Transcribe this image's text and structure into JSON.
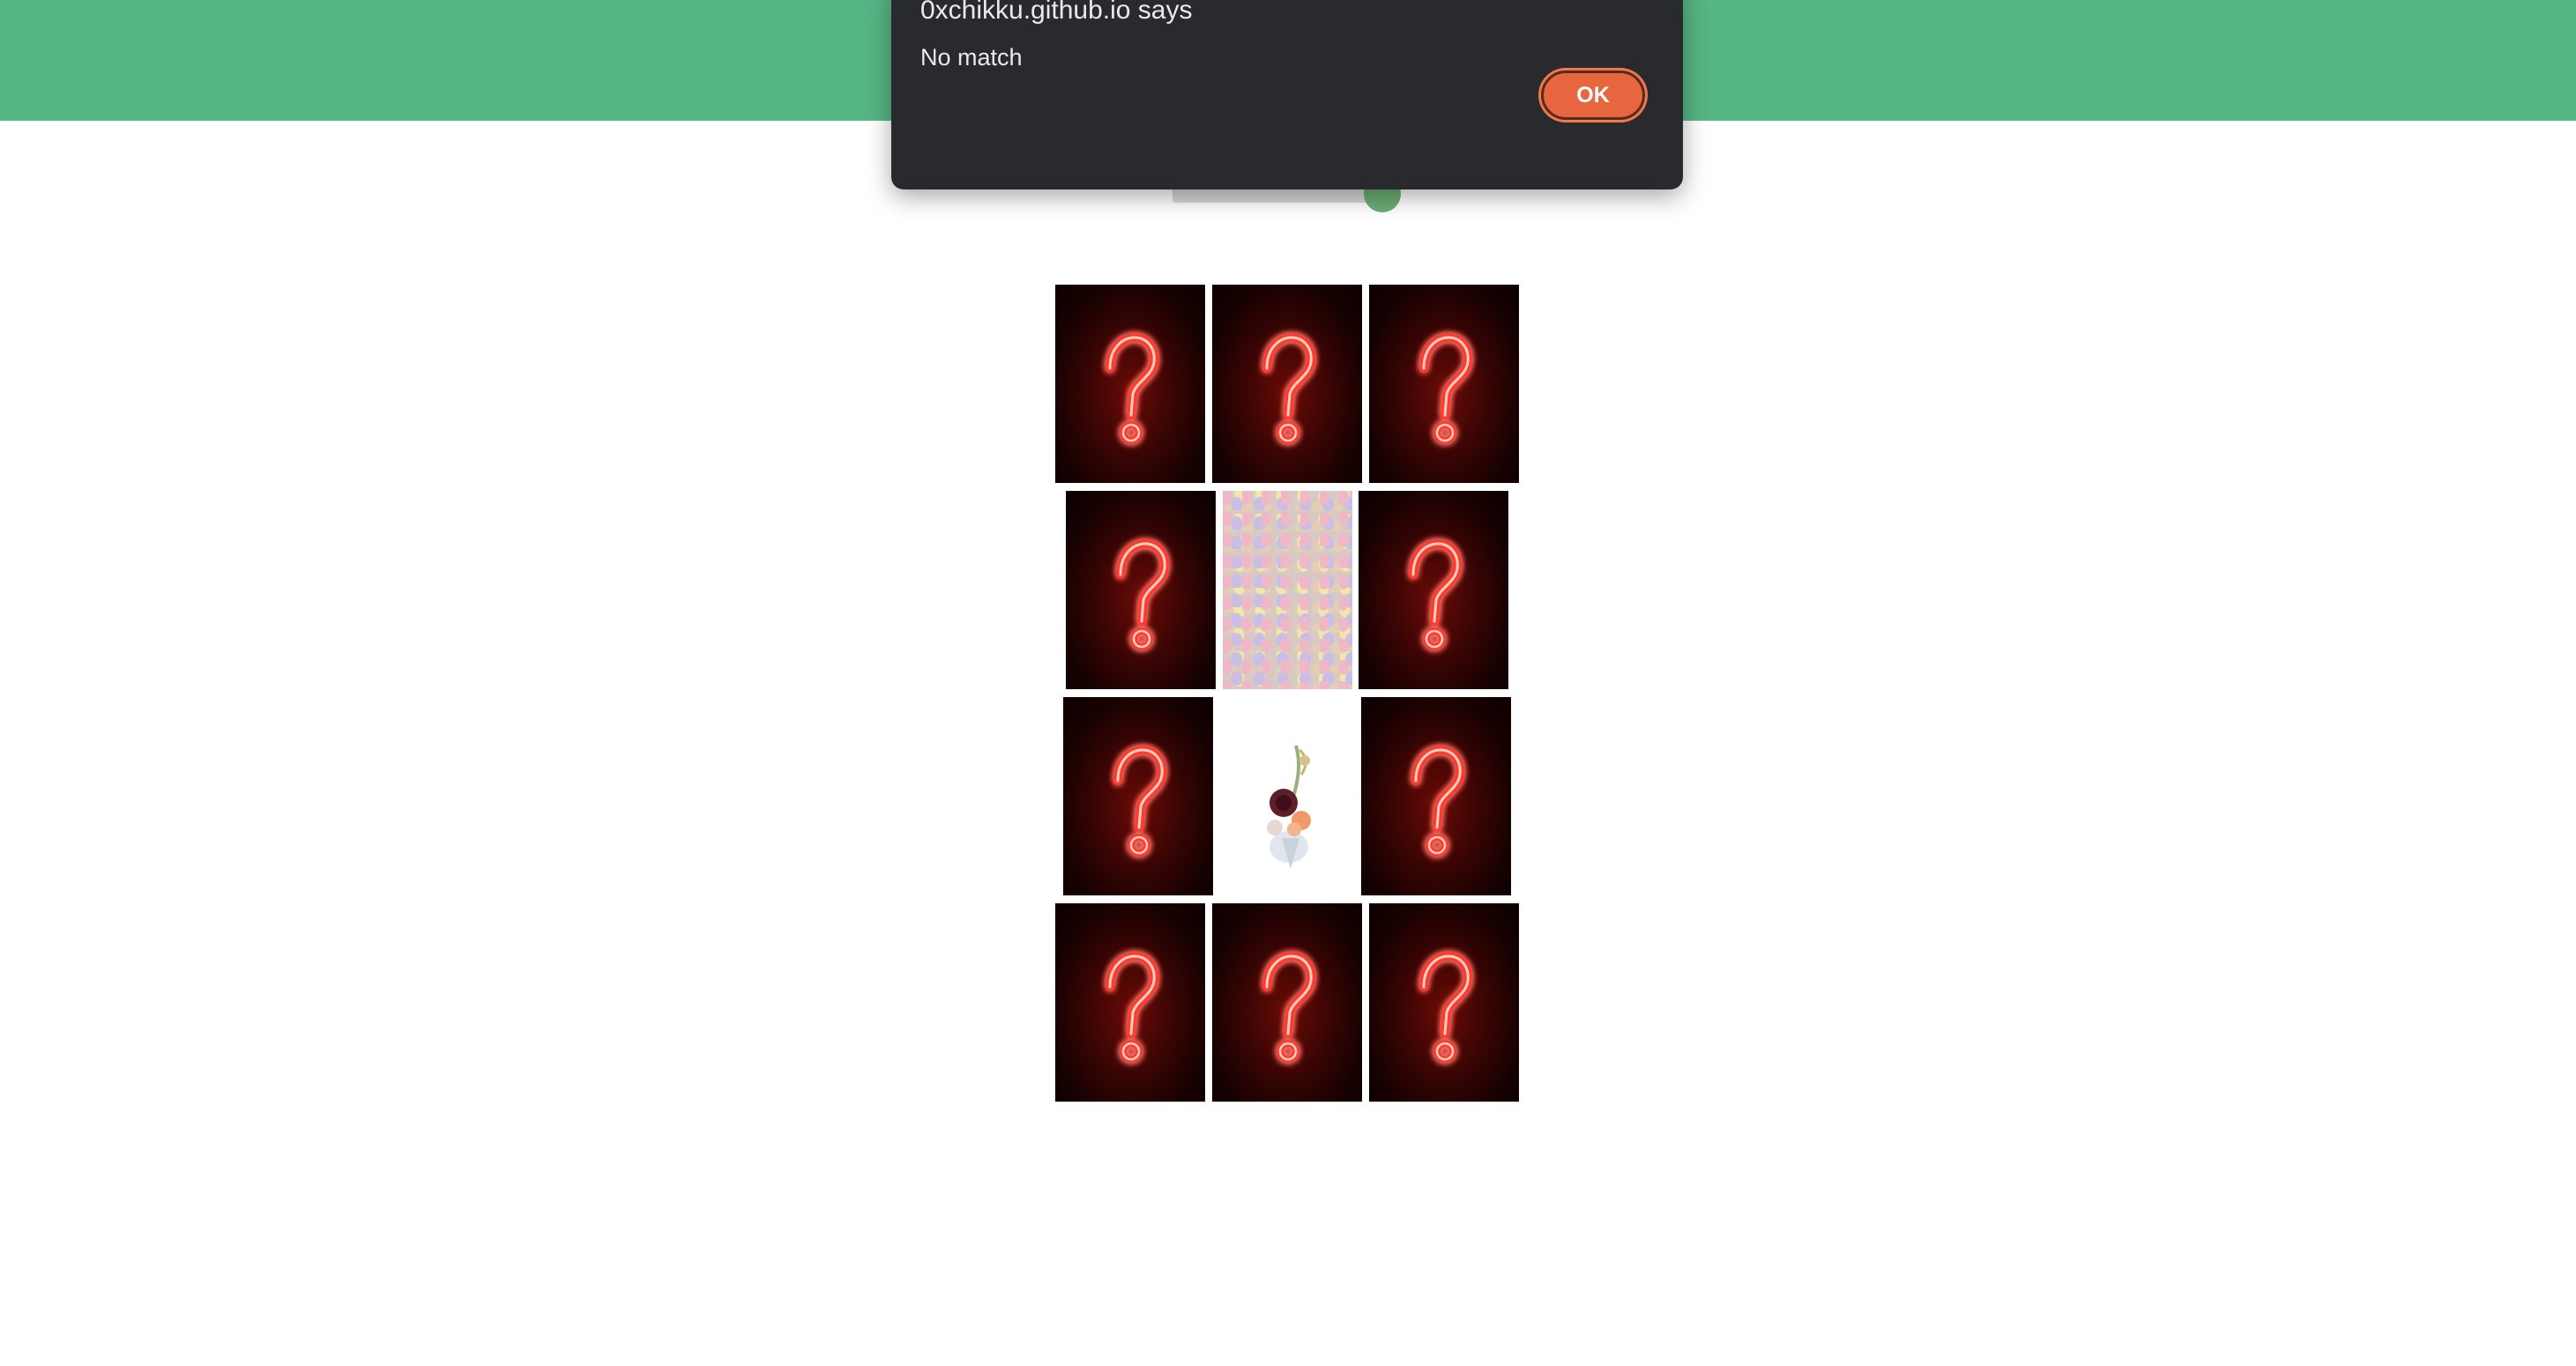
{
  "dialog": {
    "title": "0xchikku.github.io says",
    "message": "No match",
    "ok_label": "OK"
  },
  "board": {
    "rows": 4,
    "columns": 3,
    "cards": [
      {
        "row": 1,
        "col": 1,
        "face": "hidden",
        "icon": "question-mark-icon"
      },
      {
        "row": 1,
        "col": 2,
        "face": "hidden",
        "icon": "question-mark-icon"
      },
      {
        "row": 1,
        "col": 3,
        "face": "hidden",
        "icon": "question-mark-icon"
      },
      {
        "row": 2,
        "col": 1,
        "face": "hidden",
        "icon": "question-mark-icon"
      },
      {
        "row": 2,
        "col": 2,
        "face": "revealed",
        "image": "pastel-candy-eggs"
      },
      {
        "row": 2,
        "col": 3,
        "face": "hidden",
        "icon": "question-mark-icon"
      },
      {
        "row": 3,
        "col": 1,
        "face": "hidden",
        "icon": "question-mark-icon"
      },
      {
        "row": 3,
        "col": 2,
        "face": "revealed",
        "image": "flower-bouquet"
      },
      {
        "row": 3,
        "col": 3,
        "face": "hidden",
        "icon": "question-mark-icon"
      },
      {
        "row": 4,
        "col": 1,
        "face": "hidden",
        "icon": "question-mark-icon"
      },
      {
        "row": 4,
        "col": 2,
        "face": "hidden",
        "icon": "question-mark-icon"
      },
      {
        "row": 4,
        "col": 3,
        "face": "hidden",
        "icon": "question-mark-icon"
      }
    ]
  },
  "colors": {
    "header": "#56b585",
    "dialog_bg": "#292a2d",
    "ok_button": "#e7663f",
    "neon": "#ff4a3a"
  }
}
